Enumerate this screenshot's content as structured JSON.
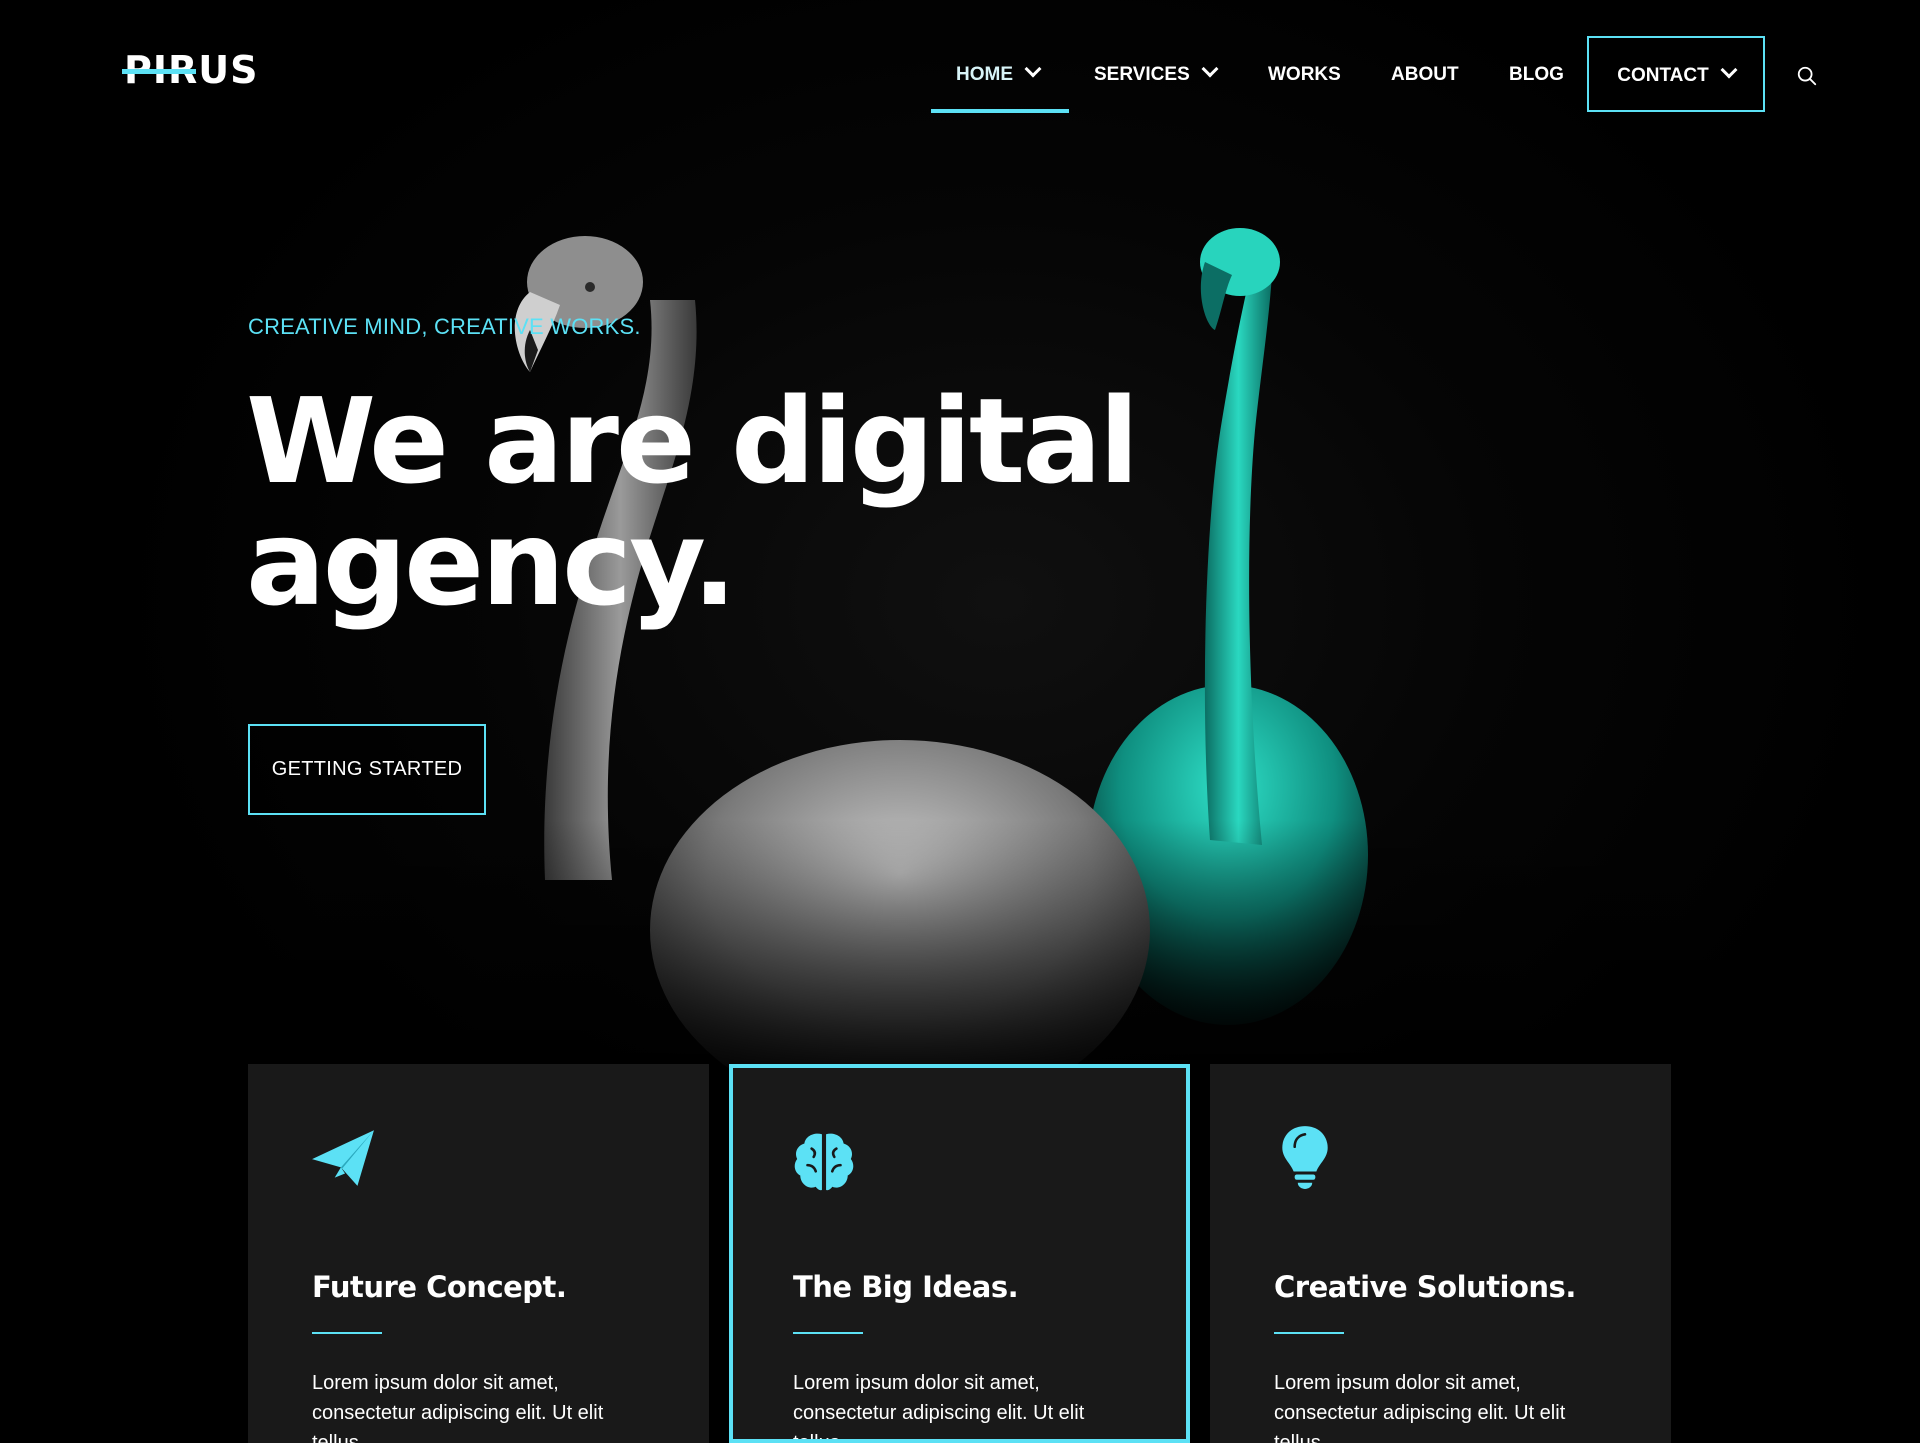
{
  "header": {
    "logo": "PIRUS",
    "nav": [
      {
        "label": "HOME",
        "has_dropdown": true,
        "active": true
      },
      {
        "label": "SERVICES",
        "has_dropdown": true,
        "active": false
      },
      {
        "label": "WORKS",
        "has_dropdown": false,
        "active": false
      },
      {
        "label": "ABOUT",
        "has_dropdown": false,
        "active": false
      },
      {
        "label": "BLOG",
        "has_dropdown": false,
        "active": false
      }
    ],
    "contact_label": "CONTACT",
    "search_icon": "search-icon"
  },
  "hero": {
    "tagline": "CREATIVE MIND, CREATIVE WORKS.",
    "title_line1": "We are digital",
    "title_line2": "agency.",
    "cta_label": "GETTING STARTED"
  },
  "features": [
    {
      "icon": "paper-plane-icon",
      "title": "Future Concept.",
      "text": "Lorem ipsum dolor sit amet, consectetur adipiscing elit. Ut elit tellus",
      "featured": false
    },
    {
      "icon": "brain-icon",
      "title": "The Big Ideas.",
      "text": "Lorem ipsum dolor sit amet, consectetur adipiscing elit. Ut elit tellus",
      "featured": true
    },
    {
      "icon": "lightbulb-icon",
      "title": "Creative Solutions.",
      "text": "Lorem ipsum dolor sit amet, consectetur adipiscing elit. Ut elit tellus",
      "featured": false
    }
  ],
  "colors": {
    "accent": "#5ce1f5",
    "background": "#000000",
    "card_background": "#191919",
    "flamingo_teal": "#1fc9b4"
  }
}
